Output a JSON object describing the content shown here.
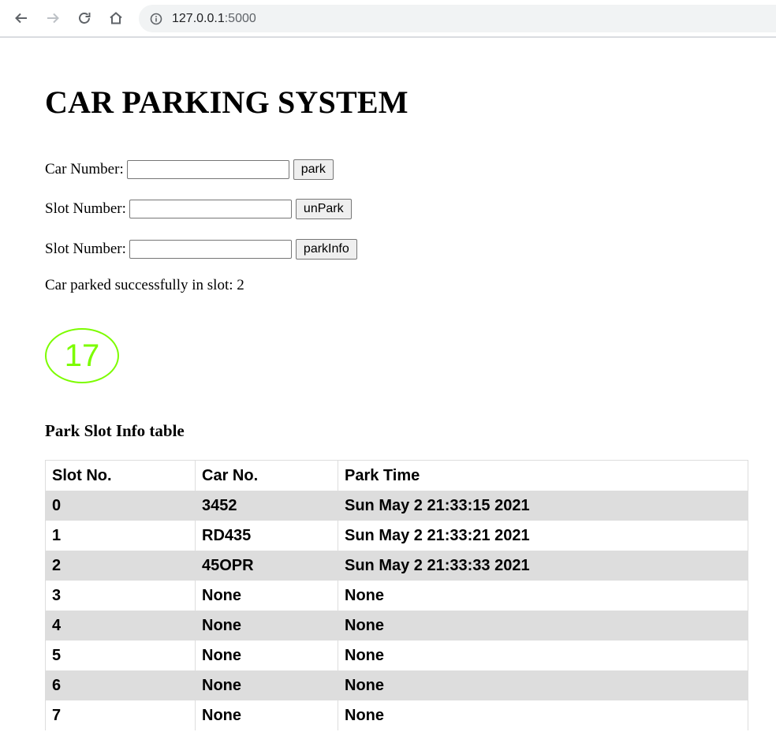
{
  "browser": {
    "url_host": "127.0.0.1",
    "url_port": ":5000"
  },
  "page": {
    "title": "CAR PARKING SYSTEM"
  },
  "forms": {
    "park": {
      "label": "Car Number:",
      "value": "",
      "button": "park"
    },
    "unpark": {
      "label": "Slot Number:",
      "value": "",
      "button": "unPark"
    },
    "parkinfo": {
      "label": "Slot Number:",
      "value": "",
      "button": "parkInfo"
    }
  },
  "status_message": "Car parked successfully in slot: 2",
  "counter": {
    "value": "17",
    "color": "#7cfc00"
  },
  "table": {
    "title": "Park Slot Info table",
    "headers": [
      "Slot No.",
      "Car No.",
      "Park Time"
    ],
    "rows": [
      [
        "0",
        "3452",
        "Sun May 2 21:33:15 2021"
      ],
      [
        "1",
        "RD435",
        "Sun May 2 21:33:21 2021"
      ],
      [
        "2",
        "45OPR",
        "Sun May 2 21:33:33 2021"
      ],
      [
        "3",
        "None",
        "None"
      ],
      [
        "4",
        "None",
        "None"
      ],
      [
        "5",
        "None",
        "None"
      ],
      [
        "6",
        "None",
        "None"
      ],
      [
        "7",
        "None",
        "None"
      ]
    ]
  }
}
